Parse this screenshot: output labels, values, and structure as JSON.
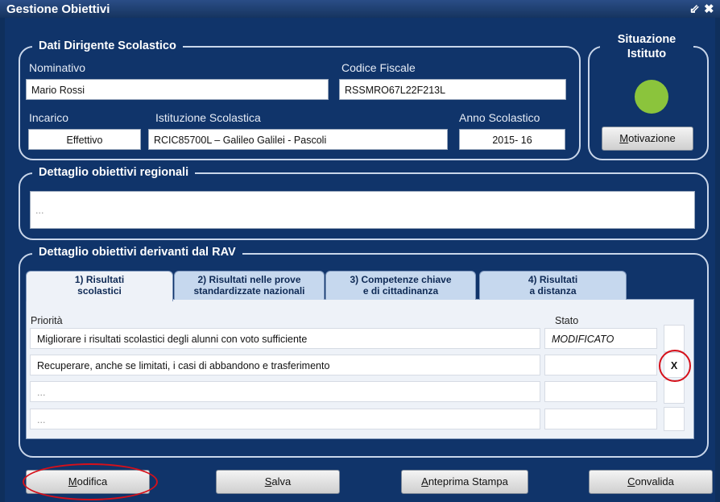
{
  "window": {
    "title": "Gestione Obiettivi",
    "ctrl_min": "⇙",
    "ctrl_close": "✖"
  },
  "dirigente": {
    "legend": "Dati Dirigente Scolastico",
    "nominativo_label": "Nominativo",
    "nominativo_value": "Mario Rossi",
    "codice_fiscale_label": "Codice Fiscale",
    "codice_fiscale_value": "RSSMRO67L22F213L",
    "incarico_label": "Incarico",
    "incarico_value": "Effettivo",
    "istituzione_label": "Istituzione Scolastica",
    "istituzione_value": "RCIC85700L – Galileo Galilei - Pascoli",
    "anno_label": "Anno Scolastico",
    "anno_value": "2015- 16"
  },
  "situazione": {
    "legend_line1": "Situazione",
    "legend_line2": "Istituto",
    "status_color": "#8bc43c",
    "motivazione_mnemonic": "M",
    "motivazione_rest": "otivazione"
  },
  "regionali": {
    "legend": "Dettaglio obiettivi regionali",
    "value": "..."
  },
  "rav": {
    "legend": "Dettaglio obiettivi derivanti dal RAV",
    "tabs": [
      {
        "line1": "1) Risultati",
        "line2": "scolastici"
      },
      {
        "line1": "2) Risultati nelle prove",
        "line2": "standardizzate nazionali"
      },
      {
        "line1": "3) Competenze chiave",
        "line2": "e di cittadinanza"
      },
      {
        "line1": "4) Risultati",
        "line2": "a distanza"
      }
    ],
    "col_priorita": "Priorità",
    "col_stato": "Stato",
    "rows": [
      {
        "priorita": "Migliorare i risultati scolastici degli alunni con voto sufficiente",
        "stato": "MODIFICATO",
        "mark": ""
      },
      {
        "priorita": "Recuperare, anche se limitati, i casi di abbandono e trasferimento",
        "stato": "",
        "mark": "X"
      },
      {
        "priorita": "...",
        "stato": "",
        "mark": ""
      },
      {
        "priorita": "...",
        "stato": "",
        "mark": ""
      }
    ]
  },
  "buttons": {
    "modifica": {
      "mnemonic": "M",
      "rest": "odifica"
    },
    "salva": {
      "mnemonic": "S",
      "rest": "alva"
    },
    "anteprima": {
      "mnemonic": "A",
      "rest": "nteprima Stampa"
    },
    "convalida": {
      "mnemonic": "C",
      "rest": "onvalida"
    }
  },
  "highlight_color": "#d6101a"
}
